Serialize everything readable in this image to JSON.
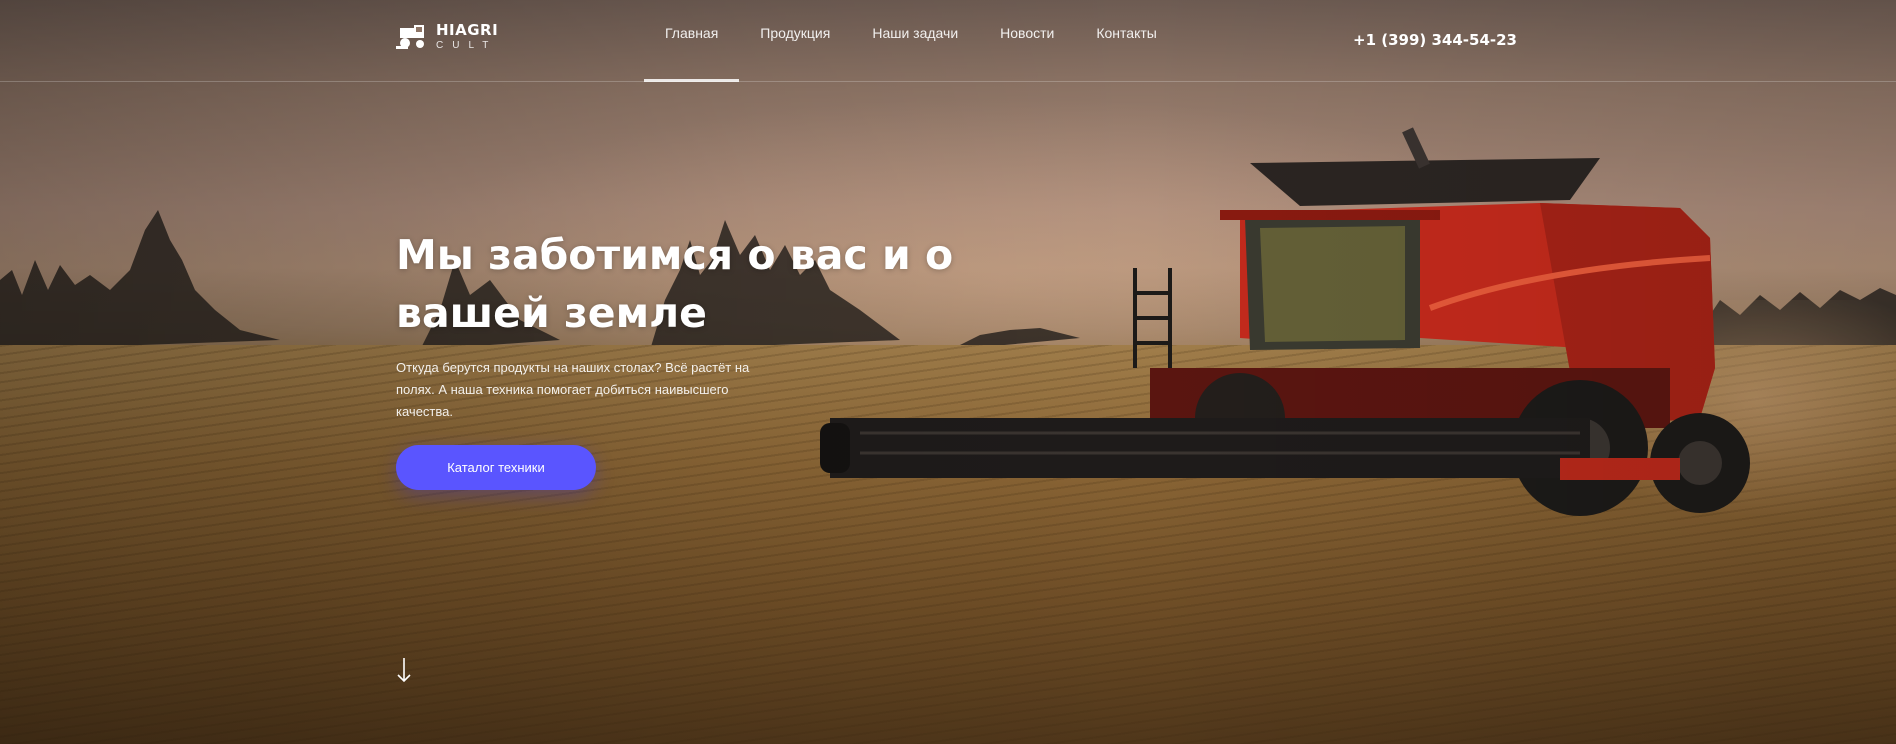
{
  "header": {
    "logo": {
      "top": "HIAGRI",
      "bottom": "CULT",
      "icon": "harvester-logo-icon"
    },
    "nav": [
      {
        "label": "Главная",
        "active": true
      },
      {
        "label": "Продукция",
        "active": false
      },
      {
        "label": "Наши задачи",
        "active": false
      },
      {
        "label": "Новости",
        "active": false
      },
      {
        "label": "Контакты",
        "active": false
      }
    ],
    "phone": "+1 (399) 344-54-23"
  },
  "hero": {
    "title": "Мы заботимся о вас и о вашей земле",
    "text": "Откуда берутся продукты на наших столах? Всё растёт на полях. А наша техника помогает добиться наивысшего качества.",
    "cta_label": "Каталог техники",
    "scroll_icon": "arrow-down-icon",
    "background_icon": "combine-harvester-image"
  },
  "colors": {
    "accent": "#5a55ff",
    "harvester_red": "#c42a1c"
  }
}
